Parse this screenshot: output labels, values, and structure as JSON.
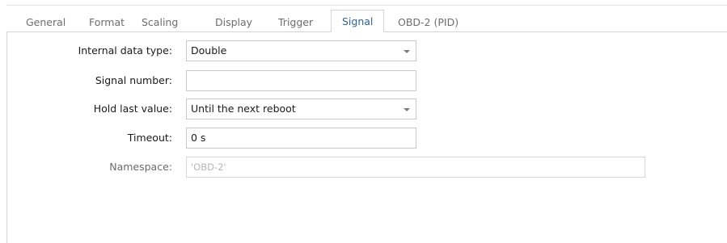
{
  "tabs": [
    {
      "label": "General"
    },
    {
      "label": "Format"
    },
    {
      "label": "Scaling"
    },
    {
      "label": "Display"
    },
    {
      "label": "Trigger"
    },
    {
      "label": "Signal",
      "active": true
    },
    {
      "label": "OBD-2 (PID)"
    }
  ],
  "form": {
    "internal_data_type": {
      "label": "Internal data type:",
      "value": "Double"
    },
    "signal_number": {
      "label": "Signal number:",
      "value": ""
    },
    "hold_last_value": {
      "label": "Hold last value:",
      "value": "Until the next reboot"
    },
    "timeout": {
      "label": "Timeout:",
      "value": "0 s"
    },
    "namespace": {
      "label": "Namespace:",
      "value": "'OBD-2'"
    }
  },
  "icons": {
    "dropdown": "chevron-down-icon"
  },
  "colors": {
    "active_tab_text": "#2f5f93",
    "inactive_tab_text": "#6d6d6d",
    "border": "#d4d4d4",
    "disabled_text": "#b6b6b6"
  }
}
